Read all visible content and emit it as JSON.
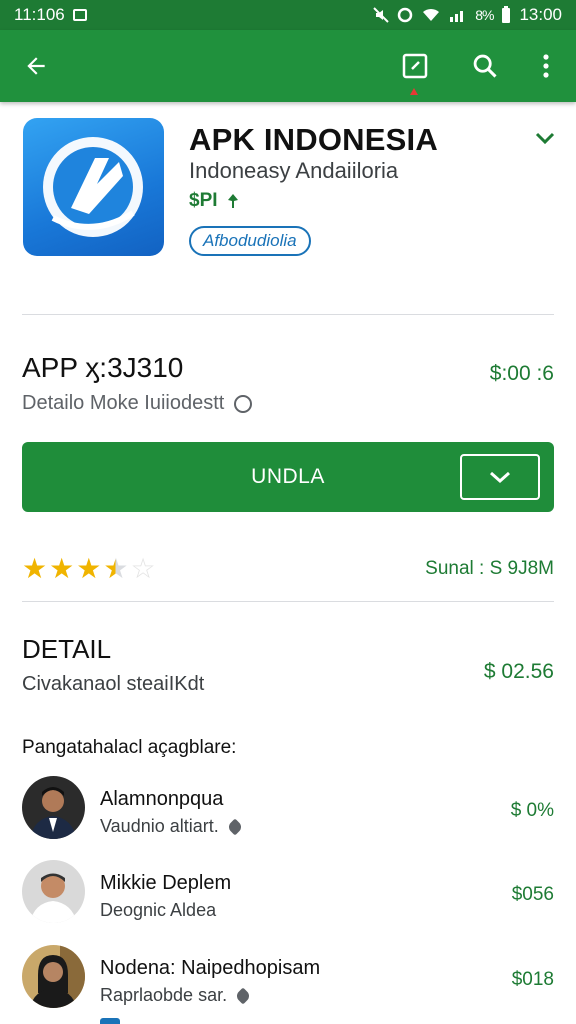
{
  "status_bar": {
    "time_left": "11:106",
    "battery": "8%",
    "time_right": "13:00"
  },
  "app_bar": {
    "back_icon": "arrow-back-icon",
    "edit_icon": "edit-icon",
    "search_icon": "search-icon",
    "more_icon": "more-vert-icon"
  },
  "app": {
    "title": "APK INDONESIA",
    "developer": "Indoneasy Andaiiloria",
    "price": "$PI",
    "tag": "Afbodudiolia"
  },
  "version": {
    "title": "APP ӽ:3J310",
    "subtitle": "Detailo Moke Iuiiodestt",
    "price": "$:00 :6"
  },
  "install": {
    "label": "UNDLA"
  },
  "rating": {
    "value": 3.5,
    "max": 5,
    "size_text": "Sunal : S 9J8M"
  },
  "detail": {
    "title": "DETAIL",
    "subtitle": "Civakanaol steaiIKdt",
    "price": "$ 02.56"
  },
  "section_label": "Pangatahalacl açagblare:",
  "reviewers": [
    {
      "name": "Alamnonpqua",
      "sub": "Vaudnio altiart.",
      "value": "$ 0%",
      "pinned": true
    },
    {
      "name": "Mikkie Deplem",
      "sub": "Deognic Aldea",
      "value": "$056",
      "pinned": false
    },
    {
      "name": "Nodena: Naipedhopisam",
      "sub": "Raprlaobde sar.",
      "value": "$018",
      "pinned": true
    }
  ],
  "colors": {
    "status_bar": "#1e7b34",
    "app_bar": "#20913d",
    "accent_green": "#1f8d3a",
    "link_blue": "#1a73b8",
    "star": "#f0b400"
  }
}
